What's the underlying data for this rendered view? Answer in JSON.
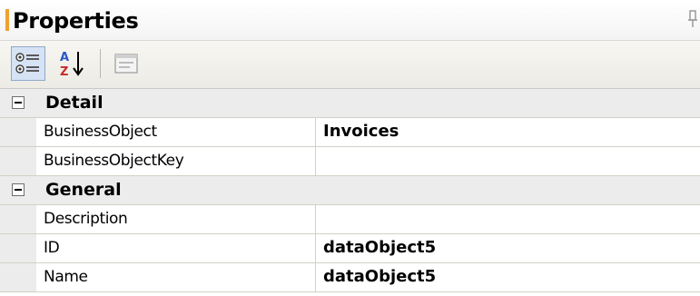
{
  "panel": {
    "title": "Properties",
    "pin_glyph": "ᵊ"
  },
  "toolbar": {
    "buttons": [
      {
        "name": "categorized-icon",
        "active": true
      },
      {
        "name": "alphabetical-icon",
        "active": false
      },
      {
        "name": "property-pages-icon",
        "active": false
      }
    ]
  },
  "grid": {
    "categories": [
      {
        "label": "Detail",
        "properties": [
          {
            "name": "BusinessObject",
            "value": "Invoices"
          },
          {
            "name": "BusinessObjectKey",
            "value": ""
          }
        ]
      },
      {
        "label": "General",
        "properties": [
          {
            "name": "Description",
            "value": ""
          },
          {
            "name": "ID",
            "value": "dataObject5"
          },
          {
            "name": "Name",
            "value": "dataObject5"
          }
        ]
      }
    ]
  },
  "colors": {
    "accent": "#f0a030",
    "category_bg": "#ececec",
    "grid_line": "#d4d0c8",
    "toolbar_bg": "#ecebe4"
  }
}
